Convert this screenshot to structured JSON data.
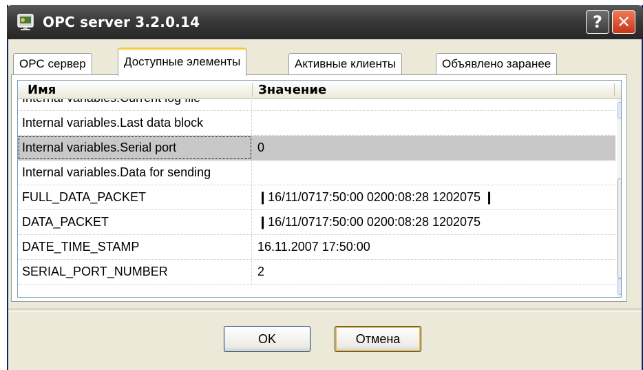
{
  "window": {
    "title": "OPC server 3.2.0.14",
    "help_label": "?",
    "close_label": "✕"
  },
  "tabs": [
    {
      "label": "OPC сервер",
      "active": false
    },
    {
      "label": "Доступные элементы",
      "active": true
    },
    {
      "label": "Активные клиенты",
      "active": false
    },
    {
      "label": "Объявлено заранее",
      "active": false
    }
  ],
  "list": {
    "columns": [
      "Имя",
      "Значение"
    ],
    "rows": [
      {
        "name": "Internal variables.Current log file",
        "value": ""
      },
      {
        "name": "Internal variables.Last data block",
        "value": ""
      },
      {
        "name": "Internal variables.Serial port",
        "value": "0",
        "selected": true
      },
      {
        "name": "Internal variables.Data for sending",
        "value": ""
      },
      {
        "name": "FULL_DATA_PACKET",
        "value": "❙16/11/0717:50:00  0200:08:28 1202075        ❙"
      },
      {
        "name": "DATA_PACKET",
        "value": "❙16/11/0717:50:00  0200:08:28 1202075"
      },
      {
        "name": "DATE_TIME_STAMP",
        "value": "16.11.2007 17:50:00"
      },
      {
        "name": "SERIAL_PORT_NUMBER",
        "value": "2"
      }
    ]
  },
  "buttons": {
    "ok": "OK",
    "cancel": "Отмена"
  },
  "colors": {
    "selection": "#c8c8c8",
    "active_tab_accent": "#ffc83c",
    "close_button": "#d9481f"
  }
}
